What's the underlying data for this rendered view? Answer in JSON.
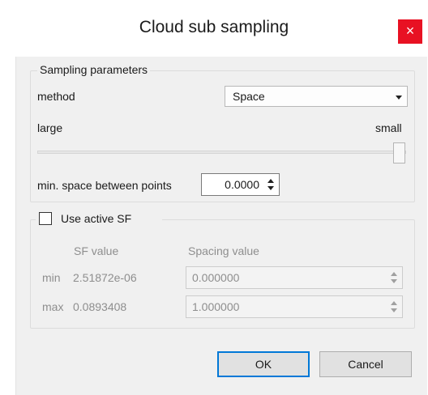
{
  "window": {
    "title": "Cloud sub sampling",
    "close_glyph": "×"
  },
  "sampling": {
    "group_title": "Sampling parameters",
    "method_label": "method",
    "method_value": "Space",
    "slider_left_label": "large",
    "slider_right_label": "small",
    "slider_level": 1.0,
    "min_space_label": "min. space between points",
    "min_space_value": "0.0000"
  },
  "active_sf": {
    "checkbox_label": "Use active SF",
    "checked": false,
    "col_sf": "SF value",
    "col_spacing": "Spacing value",
    "rows": [
      {
        "label": "min",
        "sf": "2.51872e-06",
        "spacing": "0.000000"
      },
      {
        "label": "max",
        "sf": "0.0893408",
        "spacing": "1.000000"
      }
    ]
  },
  "buttons": {
    "ok": "OK",
    "cancel": "Cancel"
  },
  "colors": {
    "close_bg": "#e81123",
    "default_button_border": "#0078d7",
    "disabled_text": "#8e8e8e"
  }
}
